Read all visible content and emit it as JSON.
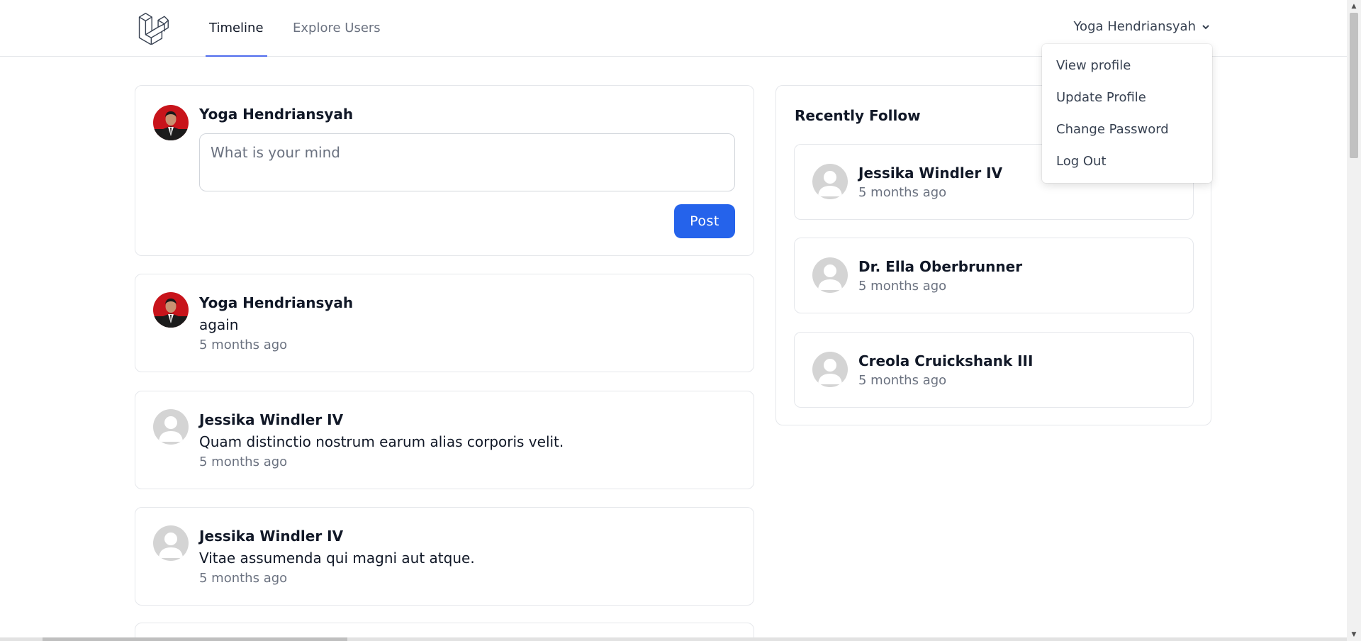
{
  "nav": {
    "tabs": [
      {
        "label": "Timeline",
        "active": true
      },
      {
        "label": "Explore Users",
        "active": false
      }
    ],
    "user_name": "Yoga Hendriansyah",
    "logo_icon": "laravel-logo-icon",
    "accent_color": "#4f6bed"
  },
  "dropdown": {
    "items": [
      "View profile",
      "Update Profile",
      "Change Password",
      "Log Out"
    ]
  },
  "composer": {
    "user_name": "Yoga Hendriansyah",
    "placeholder": "What is your mind",
    "post_label": "Post",
    "button_color": "#2563eb"
  },
  "posts": [
    {
      "author": "Yoga Hendriansyah",
      "body": "again",
      "time": "5 months ago",
      "avatar": "photo"
    },
    {
      "author": "Jessika Windler IV",
      "body": "Quam distinctio nostrum earum alias corporis velit.",
      "time": "5 months ago",
      "avatar": "default"
    },
    {
      "author": "Jessika Windler IV",
      "body": "Vitae assumenda qui magni aut atque.",
      "time": "5 months ago",
      "avatar": "default"
    }
  ],
  "recently_follow": {
    "title": "Recently Follow",
    "users": [
      {
        "name": "Jessika Windler IV",
        "time": "5 months ago"
      },
      {
        "name": "Dr. Ella Oberbrunner",
        "time": "5 months ago"
      },
      {
        "name": "Creola Cruickshank III",
        "time": "5 months ago"
      }
    ]
  }
}
